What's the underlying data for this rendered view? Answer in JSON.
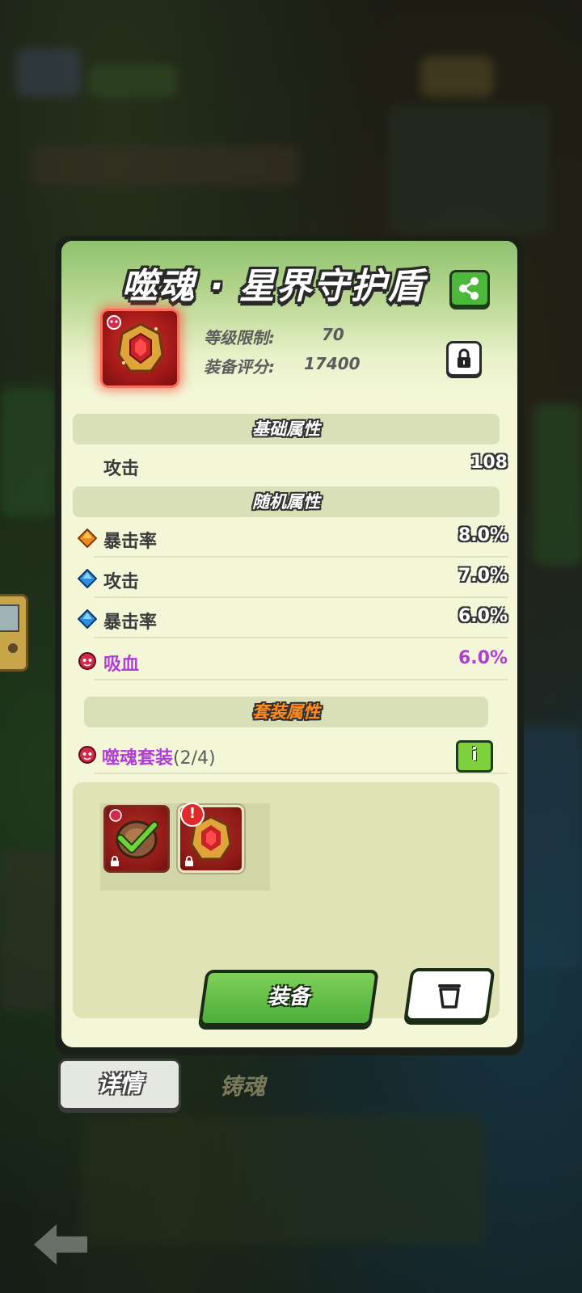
{
  "item": {
    "title": "噬魂 · 星界守护盾",
    "level_label": "等级限制:",
    "level_value": "70",
    "score_label": "装备评分:",
    "score_value": "17400"
  },
  "base_attrs": {
    "header": "基础属性",
    "rows": [
      {
        "name": "攻击",
        "value": "108"
      }
    ]
  },
  "random_attrs": {
    "header": "随机属性",
    "rows": [
      {
        "name": "暴击率",
        "value": "8.0%",
        "icon": "orange-diamond-icon"
      },
      {
        "name": "攻击",
        "value": "7.0%",
        "icon": "blue-diamond-icon"
      },
      {
        "name": "暴击率",
        "value": "6.0%",
        "icon": "blue-diamond-icon"
      },
      {
        "name": "吸血",
        "value": "6.0%",
        "icon": "soul-devour-icon"
      }
    ]
  },
  "set_attrs": {
    "header": "套装属性",
    "name": "噬魂套装",
    "progress": "(2/4)",
    "info_label": "i"
  },
  "buttons": {
    "equip": "装备"
  },
  "tabs": [
    {
      "label": "详情",
      "active": true
    },
    {
      "label": "铸魂",
      "active": false
    }
  ],
  "colors": {
    "panel_bg": "#f3f7d8",
    "accent_green": "#4cae3a",
    "purple_stat": "#b03ed6",
    "set_header_orange": "#ff8a1e"
  }
}
